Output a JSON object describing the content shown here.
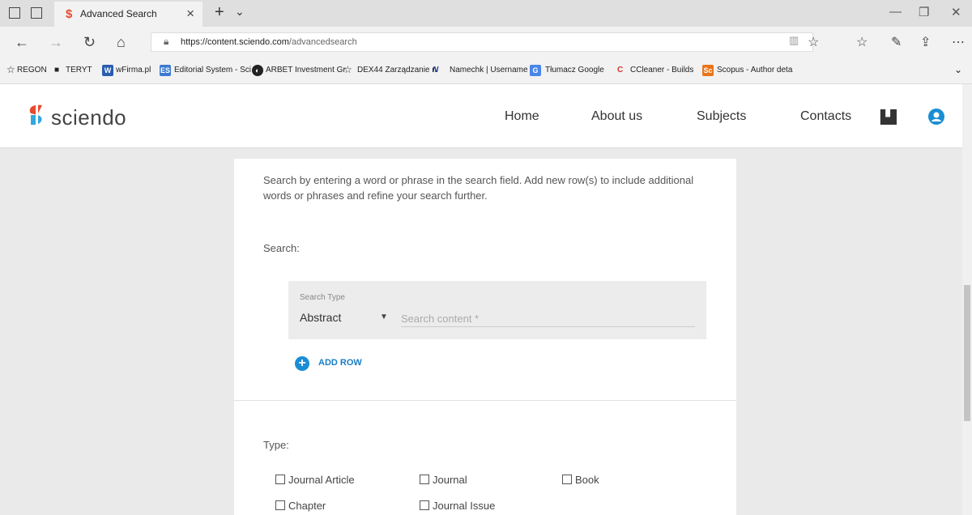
{
  "browser": {
    "tab_title": "Advanced Search",
    "url_host": "https://content.sciendo.com",
    "url_path": "/advancedsearch",
    "bookmarks": [
      "REGON",
      "TERYT",
      "wFirma.pl",
      "Editorial System - Sci",
      "ARBET Investment Gr",
      "DEX44 Zarządzanie n",
      "Namechk | Username",
      "Tłumacz Google",
      "CCleaner - Builds",
      "Scopus - Author deta"
    ]
  },
  "site": {
    "logo_text": "sciendo",
    "nav": [
      "Home",
      "About us",
      "Subjects",
      "Contacts"
    ]
  },
  "form": {
    "intro": "Search by entering a word or phrase in the search field. Add new row(s) to include additional words or phrases and refine your search further.",
    "search_label": "Search:",
    "search_type_label": "Search Type",
    "search_type_value": "Abstract",
    "search_placeholder": "Search content *",
    "add_row_label": "ADD ROW",
    "type_label": "Type:",
    "types": [
      "Journal Article",
      "Journal",
      "Book",
      "Chapter",
      "Journal Issue"
    ]
  },
  "colors": {
    "accent": "#1a8ed4",
    "logo_red": "#e84a2f",
    "logo_blue": "#2fa8de"
  }
}
